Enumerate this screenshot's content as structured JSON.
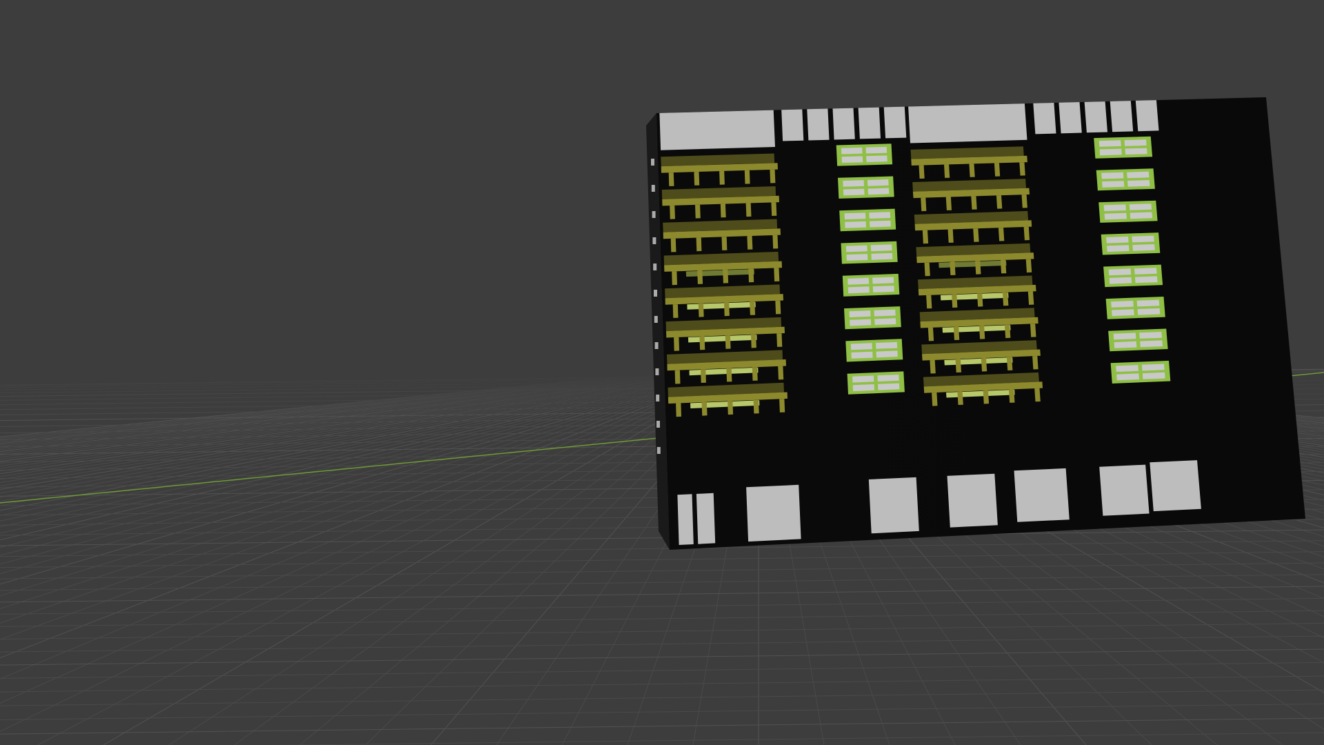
{
  "viewport": {
    "background": "#3d3d3d",
    "grid_line_color": "#4a4a4a",
    "grid_major_color": "#525252",
    "x_axis_color": "#6f9a36"
  },
  "building": {
    "face_color": "#0a0a0a",
    "slab_color": "#bdbdbd",
    "balcony_color": "#8d8a2e",
    "balcony_shadow_color": "#4e4c1a",
    "window_frame_color": "#8fc045",
    "window_pane_color": "#c9c9c9",
    "balcony_floors": 8,
    "window_floors": 8
  }
}
